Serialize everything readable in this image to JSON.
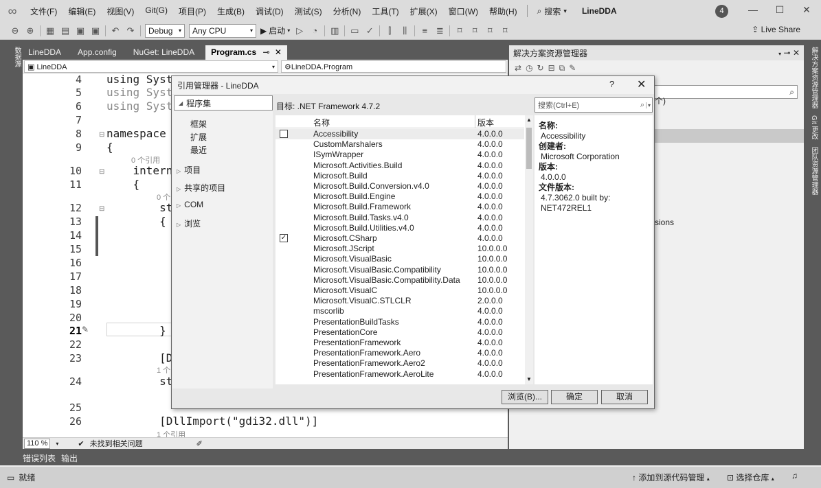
{
  "menubar": {
    "items": [
      "文件(F)",
      "编辑(E)",
      "视图(V)",
      "Git(G)",
      "项目(P)",
      "生成(B)",
      "调试(D)",
      "测试(S)",
      "分析(N)",
      "工具(T)",
      "扩展(X)",
      "窗口(W)",
      "帮助(H)"
    ],
    "search": "搜索",
    "project_name": "LineDDA",
    "notification_count": "4"
  },
  "toolbar": {
    "configuration": "Debug",
    "platform": "Any CPU",
    "start_label": "启动",
    "live_share": "Live Share"
  },
  "side_strips": {
    "left": "数据源",
    "right": [
      "解决方案资源管理器",
      "Git 更改",
      "团队资源管理器"
    ]
  },
  "editor": {
    "tabs": [
      "LineDDA",
      "App.config",
      "NuGet: LineDDA",
      "Program.cs"
    ],
    "nav_project": "LineDDA",
    "nav_class": "LineDDA.Program",
    "lines": [
      {
        "n": "4",
        "text": "using Syst"
      },
      {
        "n": "5",
        "text": "using Syst"
      },
      {
        "n": "6",
        "text": "using Syst"
      },
      {
        "n": "7",
        "text": ""
      },
      {
        "n": "8",
        "text": "namespace L"
      },
      {
        "n": "9",
        "text": "{"
      },
      {
        "n": "10",
        "text": "    interna"
      },
      {
        "n": "11",
        "text": "    {"
      },
      {
        "n": "12",
        "text": "        st"
      },
      {
        "n": "13",
        "text": "        {"
      },
      {
        "n": "14",
        "text": ""
      },
      {
        "n": "15",
        "text": ""
      },
      {
        "n": "16",
        "text": ""
      },
      {
        "n": "17",
        "text": ""
      },
      {
        "n": "18",
        "text": ""
      },
      {
        "n": "19",
        "text": ""
      },
      {
        "n": "20",
        "text": ""
      },
      {
        "n": "21",
        "text": "        }"
      },
      {
        "n": "22",
        "text": ""
      },
      {
        "n": "23",
        "text": "        [D"
      },
      {
        "n": "24",
        "text": "        st"
      },
      {
        "n": "25",
        "text": ""
      },
      {
        "n": "26",
        "text": "        [DllImport(\"gdi32.dll\")]"
      }
    ],
    "ref_labels": {
      "r9": "0 个引用",
      "r11": "0 个",
      "r23": "1 个",
      "r26": "1 个引用"
    },
    "zoom": "110 %",
    "issues": "未找到相关问题"
  },
  "bottom_tabs": [
    "错误列表",
    "输出"
  ],
  "statusbar": {
    "ready": "就绪",
    "add_source": "添加到源代码管理",
    "select_repo": "选择仓库"
  },
  "solution_explorer": {
    "title": "解决方案资源管理器",
    "partial_text_1": "个)",
    "partial_text_2": "sions"
  },
  "dialog": {
    "title": "引用管理器 - LineDDA",
    "help": "?",
    "tree_selected": "程序集",
    "tree_sub": [
      "框架",
      "扩展",
      "最近"
    ],
    "tree_nodes": [
      "项目",
      "共享的项目",
      "COM",
      "浏览"
    ],
    "target": "目标: .NET Framework 4.7.2",
    "search_placeholder": "搜索(Ctrl+E)",
    "col_name": "名称",
    "col_version": "版本",
    "rows": [
      {
        "name": "Accessibility",
        "version": "4.0.0.0",
        "checkbox": "unchecked"
      },
      {
        "name": "CustomMarshalers",
        "version": "4.0.0.0",
        "checkbox": "none"
      },
      {
        "name": "ISymWrapper",
        "version": "4.0.0.0",
        "checkbox": "none"
      },
      {
        "name": "Microsoft.Activities.Build",
        "version": "4.0.0.0",
        "checkbox": "none"
      },
      {
        "name": "Microsoft.Build",
        "version": "4.0.0.0",
        "checkbox": "none"
      },
      {
        "name": "Microsoft.Build.Conversion.v4.0",
        "version": "4.0.0.0",
        "checkbox": "none"
      },
      {
        "name": "Microsoft.Build.Engine",
        "version": "4.0.0.0",
        "checkbox": "none"
      },
      {
        "name": "Microsoft.Build.Framework",
        "version": "4.0.0.0",
        "checkbox": "none"
      },
      {
        "name": "Microsoft.Build.Tasks.v4.0",
        "version": "4.0.0.0",
        "checkbox": "none"
      },
      {
        "name": "Microsoft.Build.Utilities.v4.0",
        "version": "4.0.0.0",
        "checkbox": "none"
      },
      {
        "name": "Microsoft.CSharp",
        "version": "4.0.0.0",
        "checkbox": "checked"
      },
      {
        "name": "Microsoft.JScript",
        "version": "10.0.0.0",
        "checkbox": "none"
      },
      {
        "name": "Microsoft.VisualBasic",
        "version": "10.0.0.0",
        "checkbox": "none"
      },
      {
        "name": "Microsoft.VisualBasic.Compatibility",
        "version": "10.0.0.0",
        "checkbox": "none"
      },
      {
        "name": "Microsoft.VisualBasic.Compatibility.Data",
        "version": "10.0.0.0",
        "checkbox": "none"
      },
      {
        "name": "Microsoft.VisualC",
        "version": "10.0.0.0",
        "checkbox": "none"
      },
      {
        "name": "Microsoft.VisualC.STLCLR",
        "version": "2.0.0.0",
        "checkbox": "none"
      },
      {
        "name": "mscorlib",
        "version": "4.0.0.0",
        "checkbox": "none"
      },
      {
        "name": "PresentationBuildTasks",
        "version": "4.0.0.0",
        "checkbox": "none"
      },
      {
        "name": "PresentationCore",
        "version": "4.0.0.0",
        "checkbox": "none"
      },
      {
        "name": "PresentationFramework",
        "version": "4.0.0.0",
        "checkbox": "none"
      },
      {
        "name": "PresentationFramework.Aero",
        "version": "4.0.0.0",
        "checkbox": "none"
      },
      {
        "name": "PresentationFramework.Aero2",
        "version": "4.0.0.0",
        "checkbox": "none"
      },
      {
        "name": "PresentationFramework.AeroLite",
        "version": "4.0.0.0",
        "checkbox": "none"
      }
    ],
    "details": {
      "name_label": "名称:",
      "name_value": "Accessibility",
      "creator_label": "创建者:",
      "creator_value": "Microsoft Corporation",
      "version_label": "版本:",
      "version_value": "4.0.0.0",
      "file_version_label": "文件版本:",
      "file_version_value_1": "4.7.3062.0 built by:",
      "file_version_value_2": "NET472REL1"
    },
    "buttons": {
      "browse": "浏览(B)...",
      "ok": "确定",
      "cancel": "取消"
    }
  }
}
